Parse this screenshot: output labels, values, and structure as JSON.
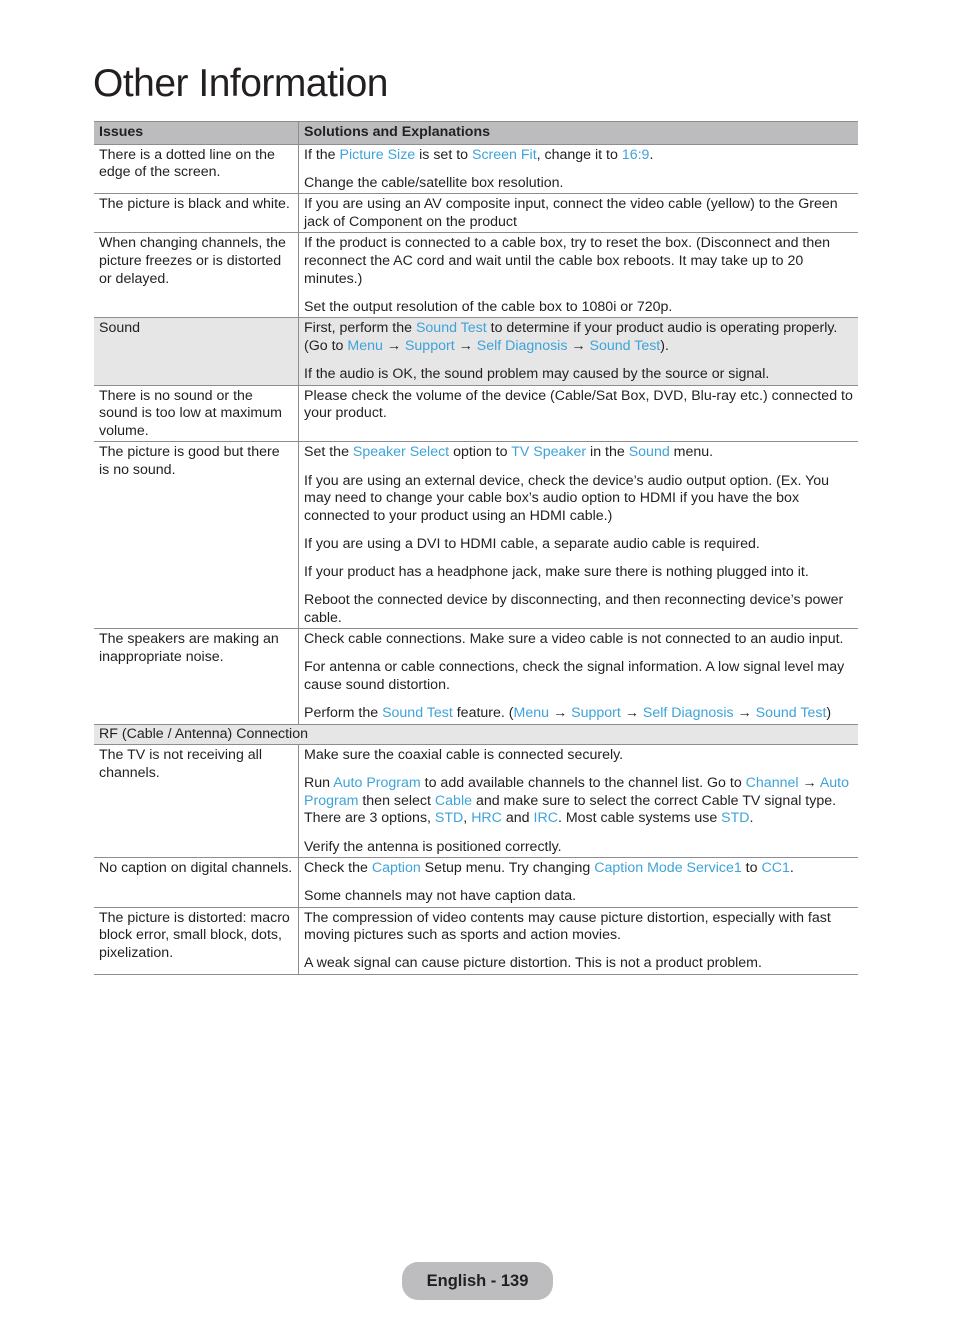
{
  "page": {
    "title": "Other Information"
  },
  "table": {
    "headers": [
      "Issues",
      "Solutions and Explanations"
    ],
    "rows": [
      {
        "type": "row",
        "issue": "There is a dotted line on the edge of the screen.",
        "solutions": [
          [
            {
              "t": "If the "
            },
            {
              "t": "Picture Size",
              "link": true
            },
            {
              "t": " is set to "
            },
            {
              "t": "Screen Fit",
              "link": true
            },
            {
              "t": ", change it to "
            },
            {
              "t": "16:9",
              "link": true
            },
            {
              "t": "."
            }
          ],
          [
            {
              "t": "Change the cable/satellite box resolution."
            }
          ]
        ]
      },
      {
        "type": "row",
        "issue": "The picture is black and white.",
        "solutions": [
          [
            {
              "t": "If you are using an AV composite input, connect the video cable (yellow) to the Green jack of Component on the product"
            }
          ]
        ]
      },
      {
        "type": "row",
        "issue": "When changing channels, the picture freezes or is distorted or delayed.",
        "solutions": [
          [
            {
              "t": "If the product is connected to a cable box, try to reset the box. (Disconnect and then reconnect the AC cord and wait until the cable box reboots. It may take up to 20 minutes.)"
            }
          ],
          [
            {
              "t": "Set the output resolution of the cable box to 1080i or 720p."
            }
          ]
        ]
      },
      {
        "type": "row",
        "shaded": true,
        "issue": "Sound",
        "solutions": [
          [
            {
              "t": "First, perform the "
            },
            {
              "t": "Sound Test",
              "link": true
            },
            {
              "t": " to determine if your product audio is operating properly. (Go to "
            },
            {
              "t": "Menu",
              "link": true
            },
            {
              "t": " → "
            },
            {
              "t": "Support",
              "link": true
            },
            {
              "t": " → "
            },
            {
              "t": "Self Diagnosis",
              "link": true
            },
            {
              "t": " → "
            },
            {
              "t": "Sound Test",
              "link": true
            },
            {
              "t": ")."
            }
          ],
          [
            {
              "t": "If the audio is OK, the sound problem may caused by the source or signal."
            }
          ]
        ]
      },
      {
        "type": "row",
        "issue": "There is no sound or the sound is too low at maximum volume.",
        "solutions": [
          [
            {
              "t": "Please check the volume of the device (Cable/Sat Box, DVD, Blu-ray etc.) connected to your product."
            }
          ]
        ]
      },
      {
        "type": "row",
        "issue": "The picture is good but there is no sound.",
        "solutions": [
          [
            {
              "t": "Set the "
            },
            {
              "t": "Speaker Select",
              "link": true
            },
            {
              "t": " option to "
            },
            {
              "t": "TV Speaker",
              "link": true
            },
            {
              "t": " in the "
            },
            {
              "t": "Sound",
              "link": true
            },
            {
              "t": " menu."
            }
          ],
          [
            {
              "t": "If you are using an external device, check the device’s audio output option. (Ex. You may need to change your cable box’s audio option to HDMI if you have the box connected to your product using an HDMI cable.)"
            }
          ],
          [
            {
              "t": "If you are using a DVI to HDMI cable, a separate audio cable is required."
            }
          ],
          [
            {
              "t": "If your product has a headphone jack, make sure there is nothing plugged into it."
            }
          ],
          [
            {
              "t": "Reboot the connected device by disconnecting, and then reconnecting device’s power cable."
            }
          ]
        ]
      },
      {
        "type": "row",
        "issue": "The speakers are making an inappropriate noise.",
        "solutions": [
          [
            {
              "t": "Check cable connections. Make sure a video cable is not connected to an audio input."
            }
          ],
          [
            {
              "t": "For antenna or cable connections, check the signal information. A low signal level may cause sound distortion."
            }
          ],
          [
            {
              "t": "Perform the "
            },
            {
              "t": "Sound Test",
              "link": true
            },
            {
              "t": " feature. ("
            },
            {
              "t": "Menu",
              "link": true
            },
            {
              "t": " → "
            },
            {
              "t": "Support",
              "link": true
            },
            {
              "t": " → "
            },
            {
              "t": "Self Diagnosis",
              "link": true
            },
            {
              "t": " → "
            },
            {
              "t": "Sound Test",
              "link": true
            },
            {
              "t": ")"
            }
          ]
        ]
      },
      {
        "type": "section",
        "label": "RF (Cable / Antenna) Connection"
      },
      {
        "type": "row",
        "issue": "The TV is not receiving all channels.",
        "solutions": [
          [
            {
              "t": "Make sure the coaxial cable is connected securely."
            }
          ],
          [
            {
              "t": "Run "
            },
            {
              "t": "Auto Program",
              "link": true
            },
            {
              "t": " to add available channels to the channel list. Go to "
            },
            {
              "t": "Channel",
              "link": true
            },
            {
              "t": " → "
            },
            {
              "t": "Auto Program",
              "link": true
            },
            {
              "t": " then select "
            },
            {
              "t": "Cable",
              "link": true
            },
            {
              "t": " and make sure to select the correct Cable TV signal type. There are 3 options, "
            },
            {
              "t": "STD",
              "link": true
            },
            {
              "t": ", "
            },
            {
              "t": "HRC",
              "link": true
            },
            {
              "t": " and "
            },
            {
              "t": "IRC",
              "link": true
            },
            {
              "t": ". Most cable systems use "
            },
            {
              "t": "STD",
              "link": true
            },
            {
              "t": "."
            }
          ],
          [
            {
              "t": "Verify the antenna is positioned correctly."
            }
          ]
        ]
      },
      {
        "type": "row",
        "issue": "No caption on digital channels.",
        "solutions": [
          [
            {
              "t": "Check the "
            },
            {
              "t": "Caption",
              "link": true
            },
            {
              "t": " Setup menu. Try changing "
            },
            {
              "t": "Caption Mode Service1",
              "link": true
            },
            {
              "t": " to "
            },
            {
              "t": "CC1",
              "link": true
            },
            {
              "t": "."
            }
          ],
          [
            {
              "t": "Some channels may not have caption data."
            }
          ]
        ]
      },
      {
        "type": "row",
        "issue": "The picture is distorted: macro block error, small block, dots, pixelization.",
        "solutions": [
          [
            {
              "t": "The compression of video contents may cause picture distortion, especially with fast moving pictures such as sports and action movies."
            }
          ],
          [
            {
              "t": "A weak signal can cause picture distortion. This is not a product problem."
            }
          ]
        ]
      }
    ]
  },
  "footer": {
    "page_label": "English - 139"
  },
  "colors": {
    "link": "#3ea3d9",
    "header_bg": "#bcbcbe",
    "shaded_bg": "#e6e6e7",
    "footer_pill": "#bdbdbf"
  }
}
